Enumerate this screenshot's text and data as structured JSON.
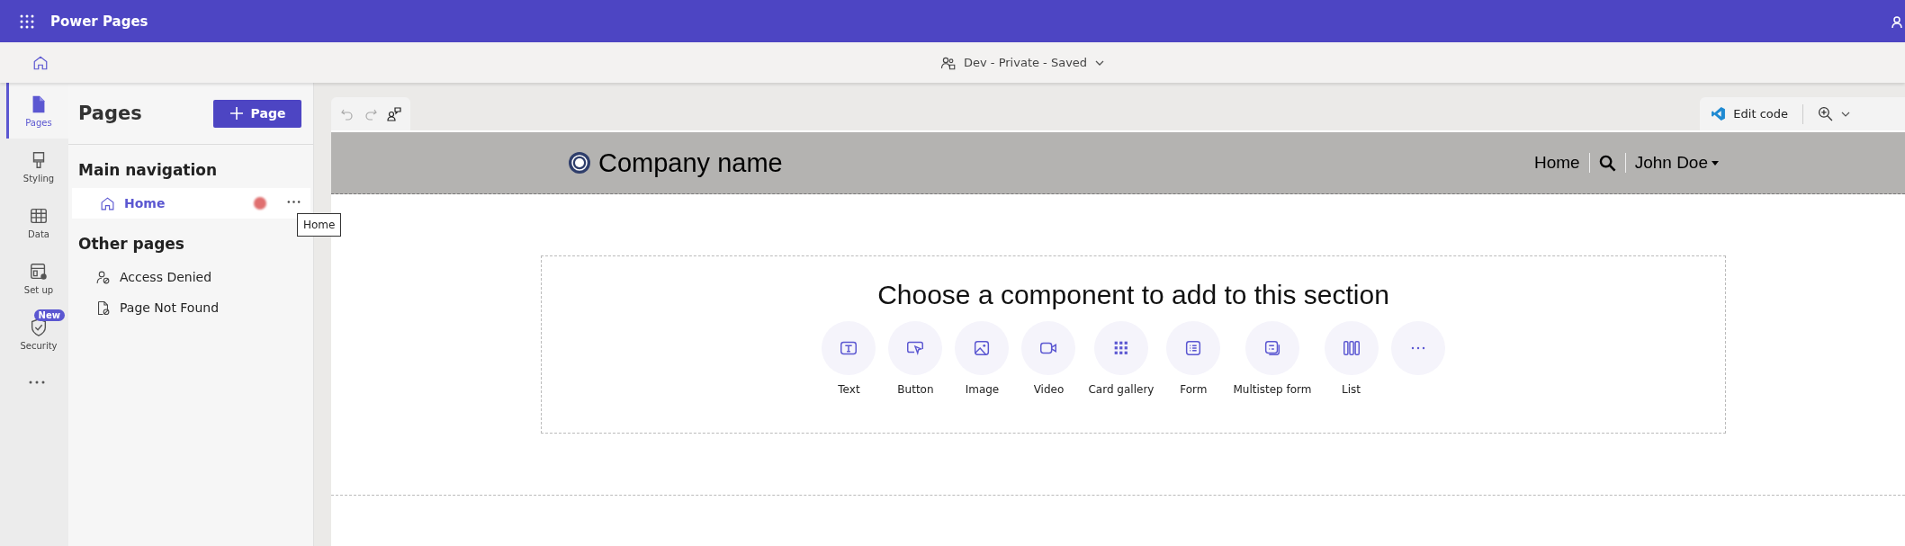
{
  "app_bar": {
    "title": "Power Pages"
  },
  "command_bar": {
    "site_label": "Dev - Private - Saved"
  },
  "rail": [
    {
      "label": "Pages",
      "kind": "pages",
      "selected": true
    },
    {
      "label": "Styling",
      "kind": "styling",
      "selected": false
    },
    {
      "label": "Data",
      "kind": "data",
      "selected": false
    },
    {
      "label": "Set up",
      "kind": "setup",
      "selected": false
    },
    {
      "label": "Security",
      "kind": "security",
      "selected": false,
      "badge": "New"
    }
  ],
  "pages_panel": {
    "title": "Pages",
    "add_button": "Page",
    "sections": [
      {
        "heading": "Main navigation",
        "items": [
          {
            "label": "Home",
            "kind": "home",
            "selected": true
          }
        ]
      },
      {
        "heading": "Other pages",
        "items": [
          {
            "label": "Access Denied",
            "kind": "access",
            "selected": false
          },
          {
            "label": "Page Not Found",
            "kind": "notfound",
            "selected": false
          }
        ]
      }
    ]
  },
  "tooltip": "Home",
  "canvas_toolbar": {
    "edit_code": "Edit code"
  },
  "preview": {
    "company_name": "Company name",
    "nav": [
      "Home"
    ],
    "user": "John Doe",
    "section": {
      "prompt": "Choose a component to add to this section",
      "components": [
        {
          "label": "Text",
          "kind": "text"
        },
        {
          "label": "Button",
          "kind": "button"
        },
        {
          "label": "Image",
          "kind": "image"
        },
        {
          "label": "Video",
          "kind": "video"
        },
        {
          "label": "Card gallery",
          "kind": "gallery"
        },
        {
          "label": "Form",
          "kind": "form"
        },
        {
          "label": "Multistep form",
          "kind": "multistep"
        },
        {
          "label": "List",
          "kind": "list"
        },
        {
          "kind": "more"
        }
      ]
    }
  }
}
